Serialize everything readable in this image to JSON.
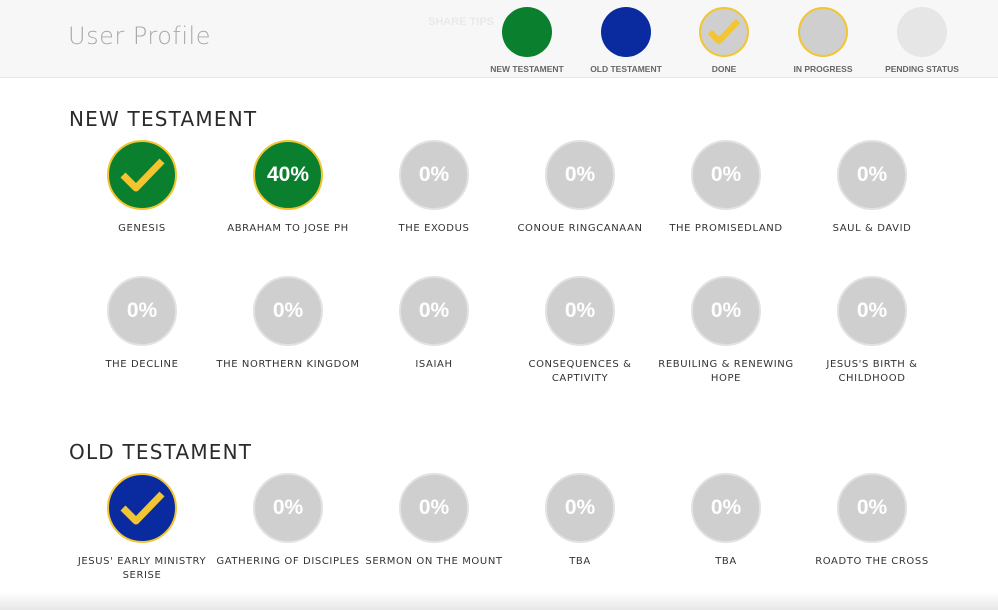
{
  "header": {
    "title": "User Profile",
    "faint_nav": "SHARE TIPS"
  },
  "legend": [
    {
      "label": "NEW TESTAMENT",
      "color": "#0a7f2e",
      "border": "#0a7f2e",
      "check": false
    },
    {
      "label": "OLD TESTAMENT",
      "color": "#0a2aa0",
      "border": "#0a2aa0",
      "check": false
    },
    {
      "label": "DONE",
      "color": "#cfcfcf",
      "border": "#f2c531",
      "check": true
    },
    {
      "label": "IN PROGRESS",
      "color": "#cfcfcf",
      "border": "#f2c531",
      "check": false
    },
    {
      "label": "PENDING STATUS",
      "color": "#e6e6e6",
      "border": "#e6e6e6",
      "check": false
    }
  ],
  "sections": {
    "new_testament": {
      "title": "NEW TESTAMENT",
      "lessons": [
        {
          "title": "GENESIS",
          "state": "done",
          "value": ""
        },
        {
          "title": "ABRAHAM TO JOSE PH",
          "state": "progress",
          "value": "40%"
        },
        {
          "title": "THE EXODUS",
          "state": "pending",
          "value": "0%"
        },
        {
          "title": "CONOUE RINGCANAAN",
          "state": "pending",
          "value": "0%"
        },
        {
          "title": "THE PROMISEDLAND",
          "state": "pending",
          "value": "0%"
        },
        {
          "title": "SAUL & DAVID",
          "state": "pending",
          "value": "0%"
        },
        {
          "title": "THE DECLINE",
          "state": "pending",
          "value": "0%"
        },
        {
          "title": "THE NORTHERN KINGDOM",
          "state": "pending",
          "value": "0%"
        },
        {
          "title": "ISAIAH",
          "state": "pending",
          "value": "0%"
        },
        {
          "title": "CONSEQUENCES & CAPTIVITY",
          "state": "pending",
          "value": "0%"
        },
        {
          "title": "REBUILING & RENEWING HOPE",
          "state": "pending",
          "value": "0%"
        },
        {
          "title": "JESUS'S BIRTH & CHILDHOOD",
          "state": "pending",
          "value": "0%"
        }
      ]
    },
    "old_testament": {
      "title": "OLD TESTAMENT",
      "lessons": [
        {
          "title": "JESUS' EARLY MINISTRY SERISE",
          "state": "done",
          "value": ""
        },
        {
          "title": "GATHERING OF DISCIPLES",
          "state": "pending",
          "value": "0%"
        },
        {
          "title": "SERMON ON THE MOUNT",
          "state": "pending",
          "value": "0%"
        },
        {
          "title": "TBA",
          "state": "pending",
          "value": "0%"
        },
        {
          "title": "TBA",
          "state": "pending",
          "value": "0%"
        },
        {
          "title": "ROADTO THE CROSS",
          "state": "pending",
          "value": "0%"
        }
      ]
    }
  }
}
